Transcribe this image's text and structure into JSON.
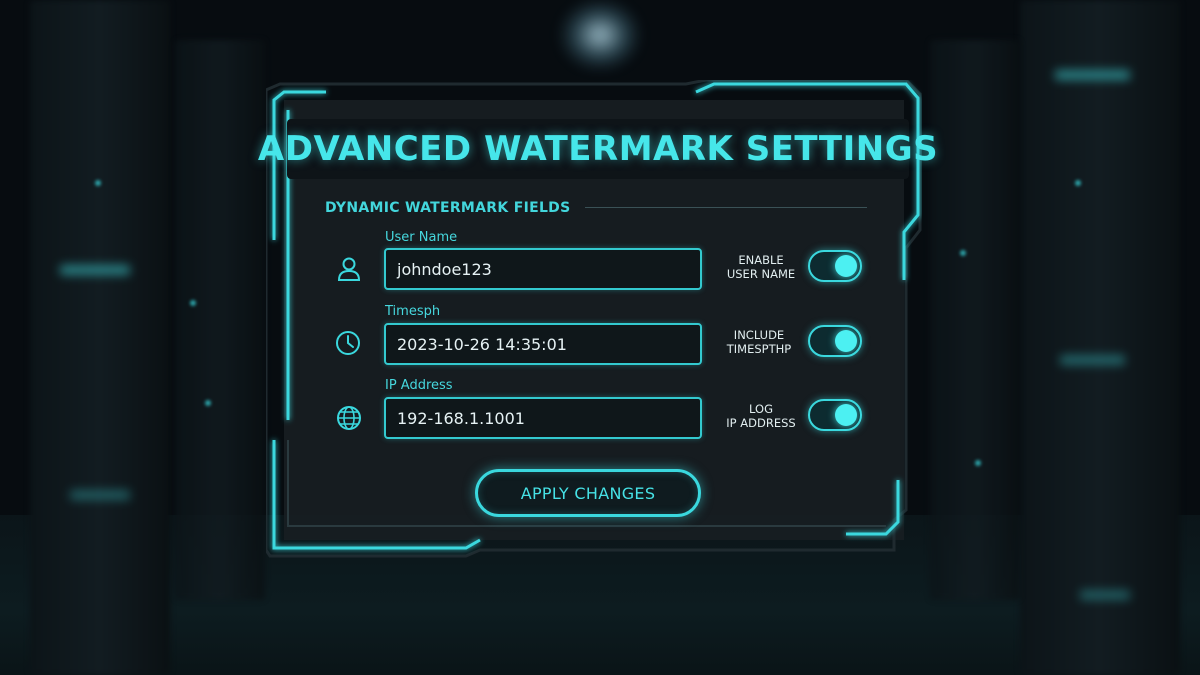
{
  "panel": {
    "title": "ADVANCED WATERMARK SETTINGS",
    "section_header": "DYNAMIC WATERMARK FIELDS"
  },
  "fields": [
    {
      "label": "User Name",
      "value": "johndoe123",
      "icon": "user-icon",
      "toggle_label_line1": "ENABLE",
      "toggle_label_line2": "USER NAME",
      "toggle_on": true
    },
    {
      "label": "Timesph",
      "value": "2023-10-26 14:35:01",
      "icon": "clock-icon",
      "toggle_label_line1": "INCLUDE",
      "toggle_label_line2": "TIMESPTHP",
      "toggle_on": true
    },
    {
      "label": "IP Address",
      "value": "192-168.1.1001",
      "icon": "globe-icon",
      "toggle_label_line1": "LOG",
      "toggle_label_line2": "IP ADDRESS",
      "toggle_on": true
    }
  ],
  "actions": {
    "apply_label": "APPLY CHANGES"
  },
  "colors": {
    "accent": "#3ad8de",
    "title": "#46e6ea",
    "panel_bg": "#181e22",
    "page_bg": "#070c10"
  }
}
